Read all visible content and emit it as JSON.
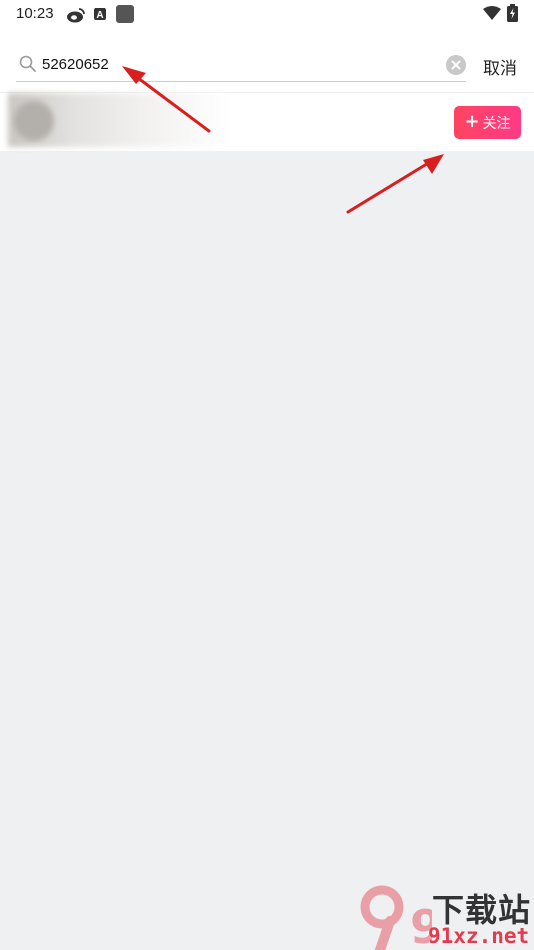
{
  "status_bar": {
    "time": "10:23",
    "icons": [
      "weibo-icon",
      "a-notification-icon",
      "app-square-icon",
      "wifi-icon",
      "battery-charging-icon"
    ]
  },
  "search": {
    "value": "52620652",
    "placeholder": "",
    "cancel_label": "取消",
    "clear_icon": "clear-circle-icon"
  },
  "result": {
    "follow_label": "关注",
    "follow_icon": "plus-icon",
    "accent_color": "#ff4070"
  },
  "annotations": {
    "arrow_color": "#d81e1e"
  },
  "watermark": {
    "logo_text": "91",
    "title": "下载站",
    "domain": "91xz.net"
  }
}
